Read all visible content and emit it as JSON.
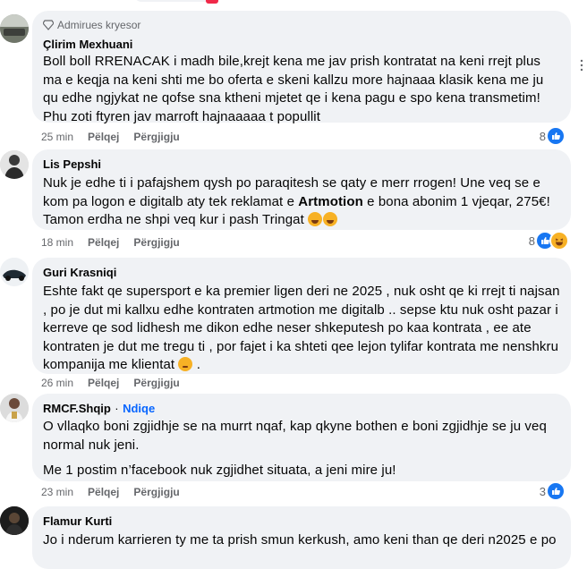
{
  "comments": [
    {
      "badge": "Admirues kryesor",
      "author": "Çlirim Mexhuani",
      "paragraphs": [
        "Boll boll RRENACAK i madh bile,krejt kena me jav prish kontratat na keni rrejt plus ma e keqja na keni shti me bo oferta e skeni kallzu more hajnaaa klasik kena me ju qu edhe ngjykat ne qofse sna ktheni mjetet qe i kena pagu e spo kena transmetim! Phu zoti ftyren jav marroft hajnaaaaa t popullit"
      ],
      "time": "25 min",
      "like_label": "Pëlqej",
      "reply_label": "Përgjigju",
      "reaction_count": "8"
    },
    {
      "author": "Lis Pepshi",
      "text_pre": "Nuk je edhe ti i pafajshem qysh po paraqitesh se qaty e merr rrogen! Une veq se e kom pa logon e digitalb aty tek reklamat e ",
      "text_bold": "Artmotion",
      "text_post": " e bona abonim 1 vjeqar, 275€! Tamon erdha ne shpi veq kur i pash Tringat",
      "time": "18 min",
      "like_label": "Pëlqej",
      "reply_label": "Përgjigju",
      "reaction_count": "8"
    },
    {
      "author": "Guri Krasniqi",
      "paragraphs": [
        "Eshte fakt qe supersport e ka premier ligen deri ne 2025 , nuk osht qe ki rrejt ti najsan , po je dut mi kallxu edhe kontraten artmotion me digitalb .. sepse ktu nuk osht pazar i kerreve qe sod lidhesh me dikon edhe neser shkeputesh po kaa kontrata , ee ate kontraten je dut me tregu ti , por fajet i ka shteti qee lejon tylifar kontrata me nenshkru kompanija me klientat",
        "."
      ],
      "time": "26 min",
      "like_label": "Pëlqej",
      "reply_label": "Përgjigju"
    },
    {
      "author": "RMCF.Shqip",
      "separator": "·",
      "follow_label": "Ndiqe",
      "paragraphs": [
        "O vllaqko boni zgjidhje se na murrt nqaf, kap qkyne bothen e boni zgjidhje se ju veq normal nuk jeni.",
        "Me 1 postim n’facebook nuk zgjidhet situata, a jeni mire ju!"
      ],
      "time": "23 min",
      "like_label": "Pëlqej",
      "reply_label": "Përgjigju",
      "reaction_count": "3"
    },
    {
      "author": "Flamur Kurti",
      "paragraphs": [
        "Jo i nderum karrieren ty me ta prish smun kerkush, amo keni than qe deri n2025 e po"
      ]
    }
  ],
  "colors": {
    "accent": "#0866ff",
    "bubble": "#f0f2f5",
    "meta": "#65676b",
    "like": "#1877f2"
  },
  "icons": {
    "badge": "diamond-badge-icon",
    "like": "like-icon",
    "haha": "haha-icon",
    "more": "more-options-icon"
  }
}
